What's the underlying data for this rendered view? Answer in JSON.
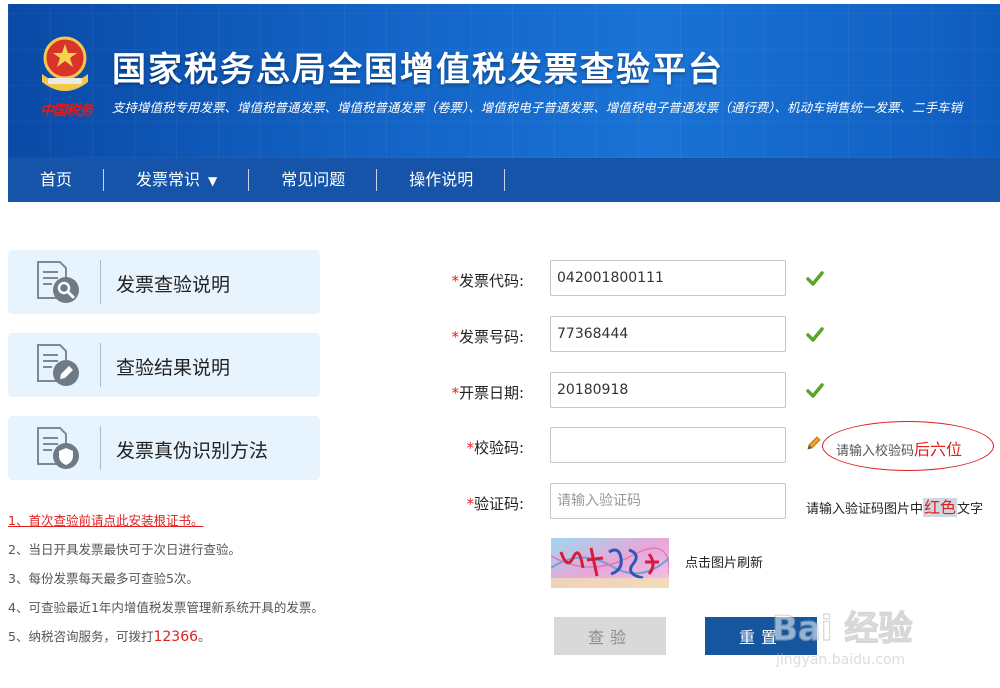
{
  "header": {
    "title": "国家税务总局全国增值税发票查验平台",
    "subtitle": "支持增值税专用发票、增值税普通发票、增值税普通发票（卷票）、增值税电子普通发票、增值税电子普通发票（通行费）、机动车销售统一发票、二手车销",
    "emblem_text": "中国税务"
  },
  "nav": {
    "items": [
      {
        "label": "首页"
      },
      {
        "label": "发票常识",
        "has_dropdown": true
      },
      {
        "label": "常见问题"
      },
      {
        "label": "操作说明"
      }
    ]
  },
  "left_panel": {
    "cards": [
      {
        "label": "发票查验说明",
        "icon": "doc-search-icon"
      },
      {
        "label": "查验结果说明",
        "icon": "doc-edit-icon"
      },
      {
        "label": "发票真伪识别方法",
        "icon": "doc-shield-icon"
      }
    ],
    "notes": [
      {
        "text": "1、首次查验前请点此安装根证书。"
      },
      {
        "text": "2、当日开具发票最快可于次日进行查验。"
      },
      {
        "text": "3、每份发票每天最多可查验5次。"
      },
      {
        "text": "4、可查验最近1年内增值税发票管理新系统开具的发票。"
      },
      {
        "text": "5、纳税咨询服务，可拨打",
        "phone": "12366",
        "suffix": "。"
      }
    ]
  },
  "form": {
    "invoice_code": {
      "required_mark": "*",
      "label": "发票代码:",
      "value": "042001800111",
      "valid": true
    },
    "invoice_number": {
      "required_mark": "*",
      "label": "发票号码:",
      "value": "77368444",
      "valid": true
    },
    "issue_date": {
      "required_mark": "*",
      "label": "开票日期:",
      "value": "20180918",
      "valid": true
    },
    "check_code": {
      "required_mark": "*",
      "label": "校验码:",
      "value": "",
      "hint_prefix": "请输入校验码",
      "hint_emphasis": "后六位"
    },
    "captcha": {
      "required_mark": "*",
      "label": "验证码:",
      "value": "",
      "placeholder": "请输入验证码",
      "hint_prefix": "请输入验证码图片中",
      "hint_emphasis": "红色",
      "hint_suffix": "文字",
      "refresh_label": "点击图片刷新"
    }
  },
  "buttons": {
    "check_label": "查验",
    "reset_label": "重置"
  },
  "watermark": {
    "brand": "Bai 经验",
    "url": "jingyan.baidu.com"
  },
  "colors": {
    "banner": "#1262c4",
    "nav": "#1554a8",
    "required": "#e02020",
    "valid_check": "#5aa629",
    "reset_button": "#15569e",
    "card_bg": "#e8f4fd"
  }
}
